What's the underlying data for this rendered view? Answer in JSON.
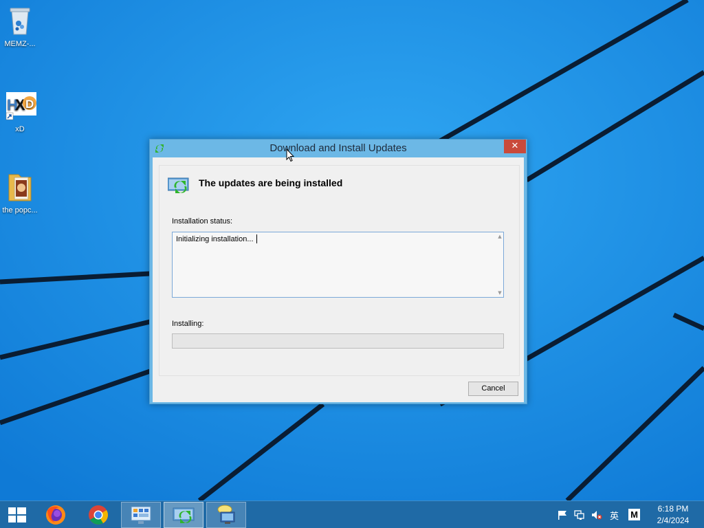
{
  "desktop": {
    "icons": [
      {
        "label": "MEMZ-...",
        "icon": "recycle-bin-icon"
      },
      {
        "label": "xD",
        "icon": "hxd-app-icon"
      },
      {
        "label": "the popc...",
        "icon": "folder-icon"
      }
    ]
  },
  "dialog": {
    "title": "Download and Install Updates",
    "close_label": "✕",
    "header": "The updates are being installed",
    "status_label": "Installation status:",
    "status_text": "Initializing installation...",
    "installing_label": "Installing:",
    "progress": 0,
    "cancel_label": "Cancel"
  },
  "taskbar": {
    "apps": [
      {
        "name": "start",
        "icon": "windows-logo-icon"
      },
      {
        "name": "firefox",
        "icon": "firefox-icon"
      },
      {
        "name": "chrome",
        "icon": "chrome-icon"
      },
      {
        "name": "control-panel",
        "icon": "control-panel-icon"
      },
      {
        "name": "windows-update",
        "icon": "update-icon"
      },
      {
        "name": "network",
        "icon": "network-icon"
      }
    ],
    "tray": {
      "language": "英",
      "ime": "M",
      "time": "6:18 PM",
      "date": "2/4/2024"
    }
  },
  "colors": {
    "wallpaper": "#1a8fe3",
    "dialog_frame": "#6cb8e6",
    "close_button": "#c94a3b",
    "taskbar": "#1f6aa6"
  }
}
